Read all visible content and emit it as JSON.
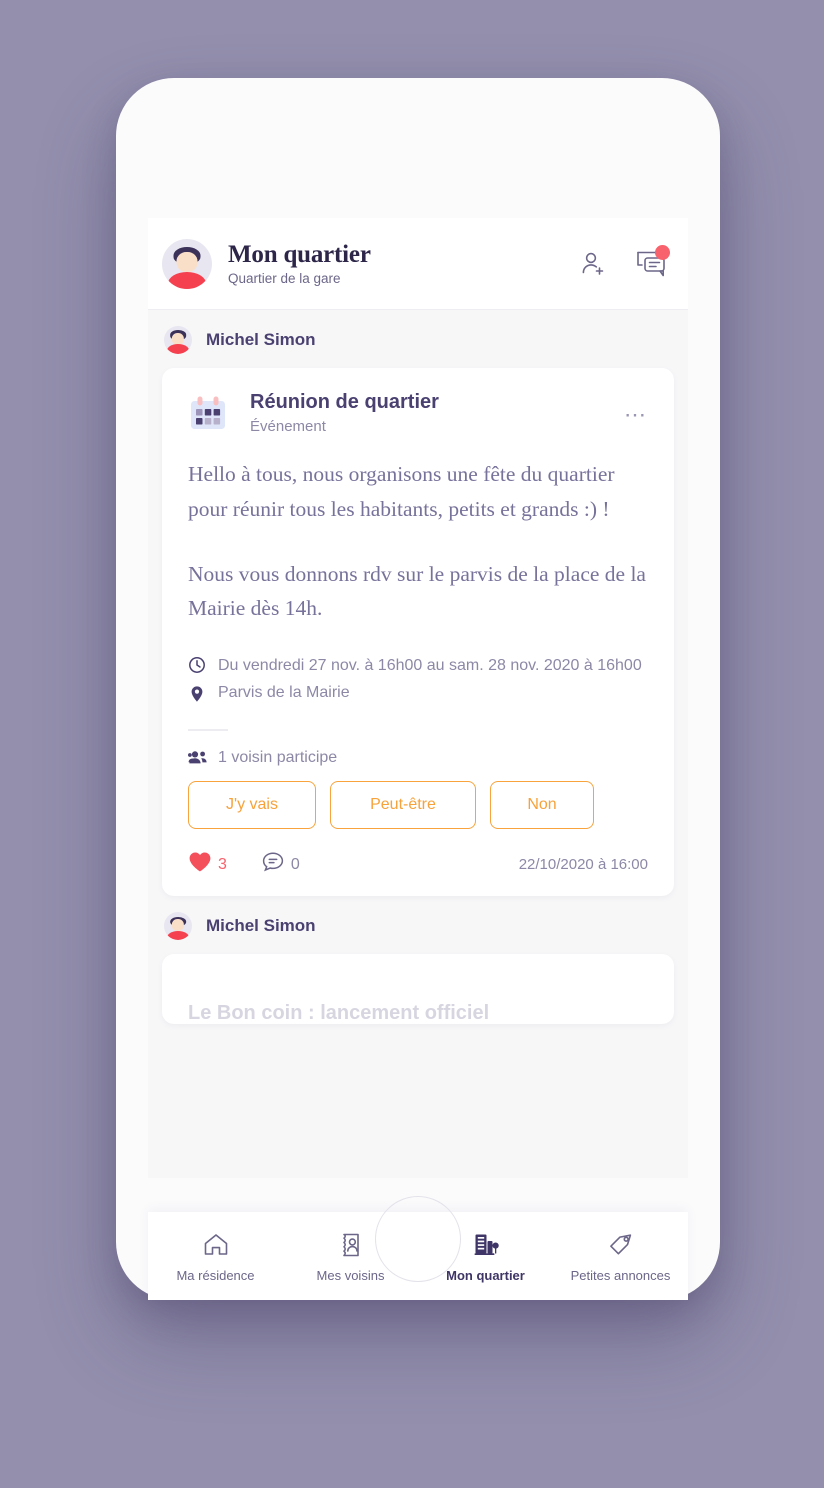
{
  "header": {
    "title": "Mon quartier",
    "subtitle": "Quartier de la gare",
    "avatar_icon": "user-avatar",
    "add_neighbor_icon": "person-add-icon",
    "messages_icon": "chat-bubble-icon",
    "messages_badge": ""
  },
  "feed": {
    "posts": [
      {
        "author": "Michel Simon",
        "card": {
          "icon": "calendar-icon",
          "title": "Réunion de quartier",
          "kind": "Événement",
          "menu": "⋯",
          "paragraphs": [
            "Hello à tous, nous organisons une fête du quartier pour réunir tous les habitants, petits et grands :) !",
            "Nous vous donnons rdv sur le parvis de la place de la Mairie dès 14h."
          ],
          "date_icon": "clock-icon",
          "date": "Du vendredi 27 nov. à 16h00 au sam. 28 nov. 2020 à 16h00",
          "location_icon": "map-pin-icon",
          "location": "Parvis de la Mairie",
          "participants_icon": "people-icon",
          "participants": "1 voisin participe",
          "rsvp": [
            {
              "label": "J'y vais"
            },
            {
              "label": "Peut-être"
            },
            {
              "label": "Non"
            }
          ],
          "likes_icon": "heart-icon",
          "likes_count": "3",
          "comments_icon": "comment-icon",
          "comments_count": "0",
          "timestamp": "22/10/2020 à 16:00"
        }
      },
      {
        "author": "Michel Simon",
        "card": {
          "title": "Le Bon coin : lancement officiel"
        }
      }
    ]
  },
  "bottom_nav": {
    "items": [
      {
        "label": "Ma résidence",
        "icon": "home-icon",
        "active": false
      },
      {
        "label": "Mes voisins",
        "icon": "contact-card-icon",
        "active": false
      },
      {
        "label": "Mon quartier",
        "icon": "buildings-icon",
        "active": true
      },
      {
        "label": "Petites annonces",
        "icon": "tag-icon",
        "active": false
      }
    ]
  },
  "device": {
    "home_button": "home-button"
  },
  "colors": {
    "background": "#938fad",
    "accent_orange": "#f7a23b",
    "accent_red": "#f8626c",
    "text_purple": "#4b4171",
    "muted_purple": "#8d88a6"
  }
}
